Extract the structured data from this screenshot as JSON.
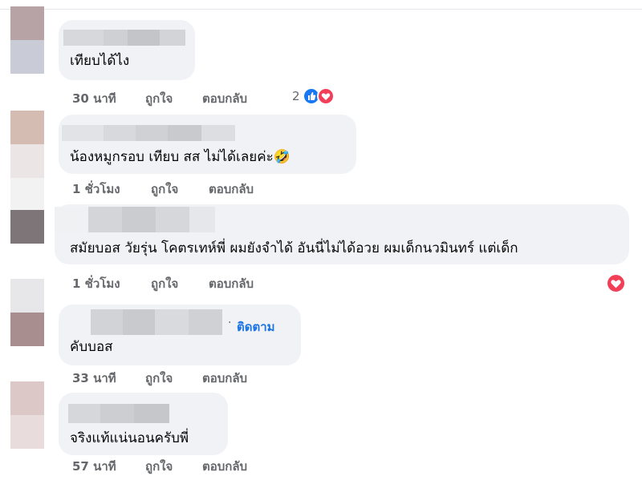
{
  "comments": [
    {
      "text": "เทียบได้ไง",
      "time": "30 นาที",
      "like_label": "ถูกใจ",
      "reply_label": "ตอบกลับ",
      "reaction_count": "2"
    },
    {
      "text": "น้องหมูกรอบ เทียบ สส ไม่ได้เลยค่ะ🤣",
      "time": "1 ชั่วโมง",
      "like_label": "ถูกใจ",
      "reply_label": "ตอบกลับ"
    },
    {
      "text": "สมัยบอส วัยรุ่น โคตรเทห์พี่ ผมยังจำได้ อันนี่ไม่ได้อวย ผมเด็กนวมินทร์ แต่เด็ก",
      "time": "1 ชั่วโมง",
      "like_label": "ถูกใจ",
      "reply_label": "ตอบกลับ"
    },
    {
      "text": "คับบอส",
      "time": "33 นาที",
      "like_label": "ถูกใจ",
      "reply_label": "ตอบกลับ",
      "follow_label": "ติดตาม"
    },
    {
      "text": "จริงแท้แน่นอนครับพี่",
      "time": "57 นาที",
      "like_label": "ถูกใจ",
      "reply_label": "ตอบกลับ"
    }
  ],
  "colors": {
    "like_blue": "#1877f2",
    "love_red": "#f33e58",
    "follow_blue": "#1b74e4",
    "meta_gray": "#65676b",
    "bubble_bg": "#f0f2f5"
  },
  "icons": [
    "like-icon",
    "love-icon"
  ]
}
